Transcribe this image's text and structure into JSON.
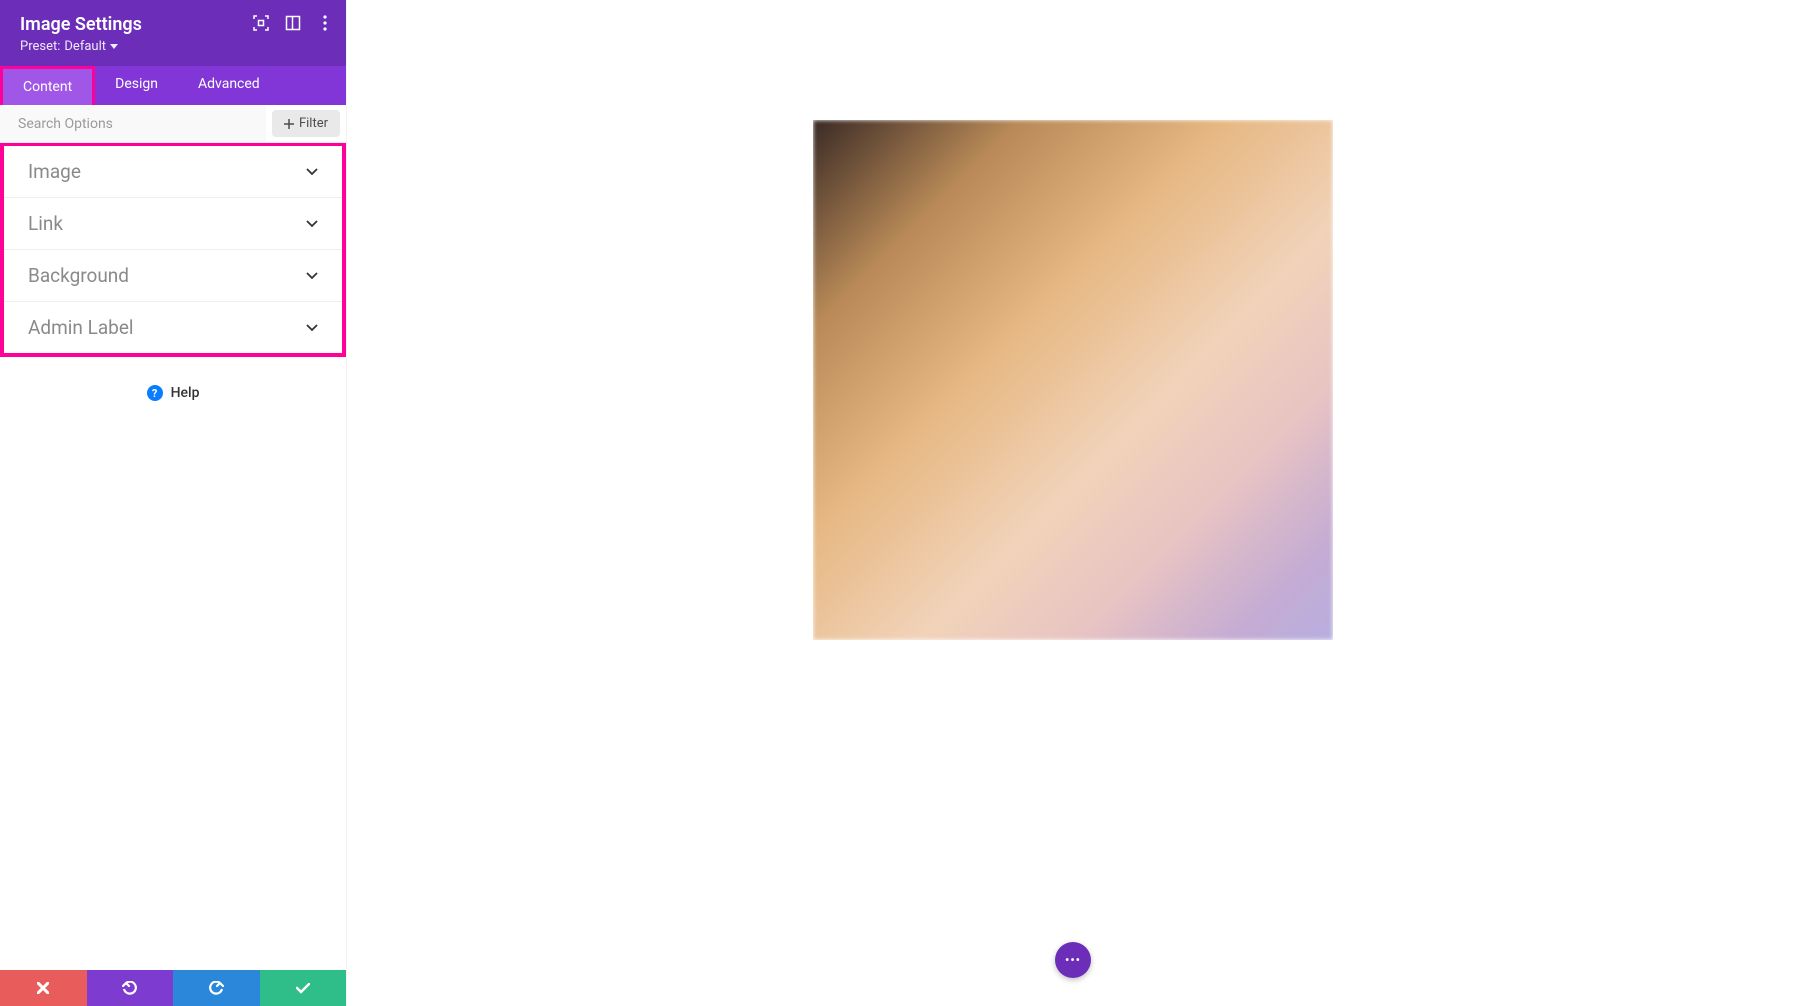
{
  "panel": {
    "title": "Image Settings",
    "preset_prefix": "Preset:",
    "preset_value": "Default"
  },
  "tabs": [
    "Content",
    "Design",
    "Advanced"
  ],
  "active_tab_index": 0,
  "search": {
    "placeholder": "Search Options",
    "filter_label": "Filter"
  },
  "sections": [
    {
      "label": "Image"
    },
    {
      "label": "Link"
    },
    {
      "label": "Background"
    },
    {
      "label": "Admin Label"
    }
  ],
  "help": {
    "label": "Help"
  },
  "fab": {
    "glyph": "•••"
  },
  "footer": {
    "cancel": "cancel",
    "undo": "undo",
    "redo": "redo",
    "save": "save"
  }
}
